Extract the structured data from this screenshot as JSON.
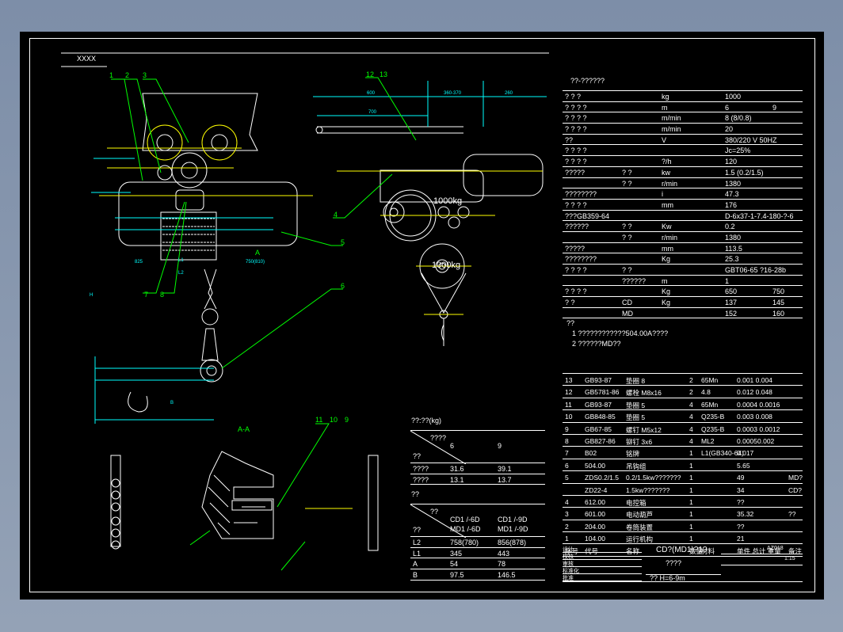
{
  "drawing_label": "XXXX",
  "balloons": [
    "1",
    "2",
    "3",
    "7",
    "8",
    "12",
    "13",
    "4",
    "5",
    "6",
    "11",
    "10",
    "9"
  ],
  "dims": {
    "top_a": "600",
    "top_b": "360-370",
    "top_c": "260",
    "top_d": "700",
    "l1": "L1",
    "l2": "L2",
    "a": "A",
    "b": "B",
    "h": "H",
    "ll": "825",
    "rr": "750(810)"
  },
  "section_label": "A-A",
  "sheave_labels": [
    "1000kg",
    "1000kg"
  ],
  "spec_table": {
    "title": "??-??????",
    "rows": [
      [
        "? ? ?",
        "",
        "kg",
        "1000",
        ""
      ],
      [
        "? ? ? ?",
        "",
        "m",
        "6",
        "9"
      ],
      [
        "? ? ? ?",
        "",
        "m/min",
        "8 (8/0.8)",
        ""
      ],
      [
        "? ? ? ?",
        "",
        "m/min",
        "20",
        ""
      ],
      [
        "??",
        "",
        "V",
        "380/220 V    50HZ",
        ""
      ],
      [
        "? ? ? ?",
        "",
        "",
        "Jc=25%",
        ""
      ],
      [
        "? ? ? ?",
        "",
        "?/h",
        "120",
        ""
      ],
      [
        "?????",
        "? ?",
        "kw",
        "1.5   (0.2/1.5)",
        ""
      ],
      [
        "",
        "? ?",
        "r/min",
        "1380",
        ""
      ],
      [
        "????????",
        "",
        "i",
        "47.3",
        ""
      ],
      [
        "? ? ? ?",
        "",
        "mm",
        "176",
        ""
      ],
      [
        "???GB359-64",
        "",
        "",
        "D-6x37-1-7.4-180-?-6",
        ""
      ],
      [
        "??????",
        "? ?",
        "Kw",
        "0.2",
        ""
      ],
      [
        "",
        "? ?",
        "r/min",
        "1380",
        ""
      ],
      [
        "?????",
        "",
        "mm",
        "113.5",
        ""
      ],
      [
        "????????",
        "",
        "Kg",
        "25.3",
        ""
      ],
      [
        "? ? ? ?",
        "? ?",
        "",
        "GBT06-65    ?16-28b",
        ""
      ],
      [
        "",
        "??????",
        "m",
        "1",
        ""
      ],
      [
        "? ? ? ?",
        "",
        "Kg",
        "650",
        "750"
      ],
      [
        "?        ?",
        "CD",
        "Kg",
        "137",
        "145"
      ],
      [
        "",
        "MD",
        "",
        "152",
        "160"
      ]
    ],
    "notes_title": "??",
    "notes": [
      "1 ????????????504.00A????",
      "2 ??????MD??"
    ]
  },
  "parts": [
    [
      "13",
      "GB93-87",
      "垫圈 8",
      "2",
      "65Mn",
      "0.001  0.004",
      ""
    ],
    [
      "12",
      "GB5781-86",
      "螺栓 M8x16",
      "2",
      "4.8",
      "0.012  0.048",
      ""
    ],
    [
      "11",
      "GB93-87",
      "垫圈 5",
      "4",
      "65Mn",
      "0.0004  0.0016",
      ""
    ],
    [
      "10",
      "GB848-85",
      "垫圈 5",
      "4",
      "Q235-B",
      "0.003  0.008",
      ""
    ],
    [
      "9",
      "GB67-85",
      "螺钉 M5x12",
      "4",
      "Q235-B",
      "0.0003  0.0012",
      ""
    ],
    [
      "8",
      "GB827-86",
      "铆钉 3x6",
      "4",
      "ML2",
      "0.00050.002",
      ""
    ],
    [
      "7",
      "B02",
      "铭牌",
      "1",
      "L1(GB340-64)",
      "0.017",
      ""
    ],
    [
      "6",
      "504.00",
      "吊钩组",
      "1",
      "",
      "5.65",
      ""
    ],
    [
      "5",
      "ZDS0.2/1.5",
      "0.2/1.5kw???????",
      "1",
      "",
      "49",
      "MD?"
    ],
    [
      "",
      "ZD22-4",
      "1.5kw???????",
      "1",
      "",
      "34",
      "CD?"
    ],
    [
      "4",
      "612.00",
      "电控箱",
      "1",
      "",
      "??",
      ""
    ],
    [
      "3",
      "601.00",
      "电动葫芦",
      "1",
      "",
      "35.32",
      "??"
    ],
    [
      "2",
      "204.00",
      "卷筒装置",
      "1",
      "",
      "??",
      ""
    ],
    [
      "1",
      "104.00",
      "运行机构",
      "1",
      "",
      "21",
      ""
    ],
    [
      "序号",
      "代号",
      "名称",
      "数量",
      "材料",
      "单件 总计 重量",
      "备注"
    ]
  ],
  "title_block": {
    "name": "CD?(MD1)?1?",
    "sub": "????",
    "spec": "??    H=6-9m",
    "code": "AZ018",
    "scale": "1:15",
    "left": [
      "设计",
      "校核",
      "审核",
      "标准化",
      "批准"
    ]
  },
  "weight_table": {
    "title": "??:??(kg)",
    "corner_top": "????",
    "corner_bottom": "??",
    "cols": [
      "6",
      "9"
    ],
    "rows": [
      [
        "????",
        "31.6",
        "39.1"
      ],
      [
        "????",
        "13.1",
        "13.7"
      ]
    ]
  },
  "dim_table": {
    "title": "??",
    "corner_top": "??",
    "corner_bottom": "??",
    "cols": [
      "CD1 /-6D\nMD1 /-6D",
      "CD1 /-9D\nMD1 /-9D"
    ],
    "rows": [
      [
        "L2",
        "758(780)",
        "856(878)"
      ],
      [
        "L1",
        "345",
        "443"
      ],
      [
        "A",
        "54",
        "78"
      ],
      [
        "B",
        "97.5",
        "146.5"
      ]
    ]
  },
  "colors": {
    "bg": "#000000",
    "line": "#ffffff",
    "dim": "#00ffff",
    "leader": "#00ff00",
    "center": "#ffff00"
  }
}
